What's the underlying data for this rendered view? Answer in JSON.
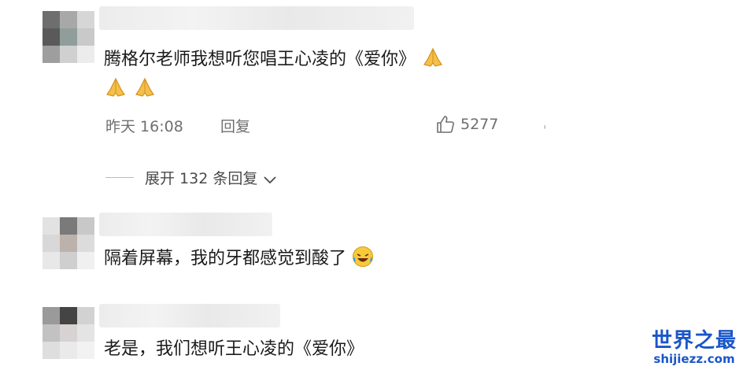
{
  "comments": [
    {
      "text": "腾格尔老师我想听您唱王心凌的《爱你》",
      "time": "昨天 16:08",
      "reply_label": "回复",
      "like_count": "5277",
      "expand_label": "展开 132 条回复"
    },
    {
      "text": "隔着屏幕，我的牙都感觉到酸了"
    },
    {
      "text": "老是，我们想听王心凌的《爱你》"
    }
  ],
  "watermark": {
    "cn": "世界之最",
    "en": "shijiezz.com"
  }
}
